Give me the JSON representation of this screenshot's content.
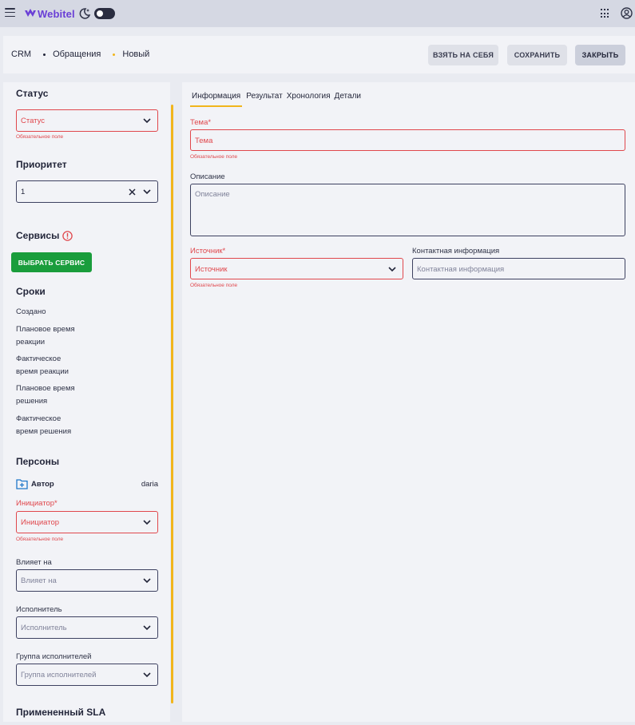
{
  "topbar": {
    "logo_text": "Webitel",
    "icons": [
      "menu-icon",
      "moon-icon",
      "toggle-switch",
      "apps-grid-icon",
      "user-icon"
    ]
  },
  "header": {
    "breadcrumb": [
      "CRM",
      "Обращения",
      "Новый"
    ],
    "buttons": {
      "take": "ВЗЯТЬ НА СЕБЯ",
      "save": "СОХРАНИТЬ",
      "close": "ЗАКРЫТЬ"
    }
  },
  "left": {
    "status": {
      "title": "Статус",
      "placeholder": "Статус",
      "hint": "Обязательное поле"
    },
    "priority": {
      "title": "Приоритет",
      "value": "1"
    },
    "services": {
      "title": "Сервисы",
      "button": "ВЫБРАТЬ СЕРВИС"
    },
    "terms": {
      "title": "Сроки",
      "items": [
        [
          "Создано"
        ],
        [
          "Плановое время",
          "реакции"
        ],
        [
          "Фактическое",
          "время реакции"
        ],
        [
          "Плановое время",
          "решения"
        ],
        [
          "Фактическое",
          "время решения"
        ]
      ]
    },
    "persons": {
      "title": "Персоны",
      "author_label": "Автор",
      "author_value": "daria",
      "initiator_label": "Инициатор*",
      "initiator_placeholder": "Инициатор",
      "initiator_hint": "Обязательное поле",
      "impacted_label": "Влияет на",
      "impacted_placeholder": "Влияет на",
      "assignee_label": "Исполнитель",
      "assignee_placeholder": "Исполнитель",
      "group_label": "Группа исполнителей",
      "group_placeholder": "Группа исполнителей"
    },
    "sla_title": "Примененный SLA"
  },
  "right": {
    "tabs": [
      "Информация",
      "Результат",
      "Хронология",
      "Детали"
    ],
    "active_tab": 0,
    "subject": {
      "label": "Тема*",
      "placeholder": "Тема",
      "hint": "Обязательное поле"
    },
    "description": {
      "label": "Описание",
      "placeholder": "Описание"
    },
    "source": {
      "label": "Источник*",
      "placeholder": "Источник",
      "hint": "Обязательное поле"
    },
    "contact": {
      "label": "Контактная информация",
      "placeholder": "Контактная информация"
    }
  },
  "colors": {
    "accent": "#f1b51c",
    "error": "#e0474c",
    "success": "#1a9d3c",
    "brand": "#6a3fd6"
  }
}
